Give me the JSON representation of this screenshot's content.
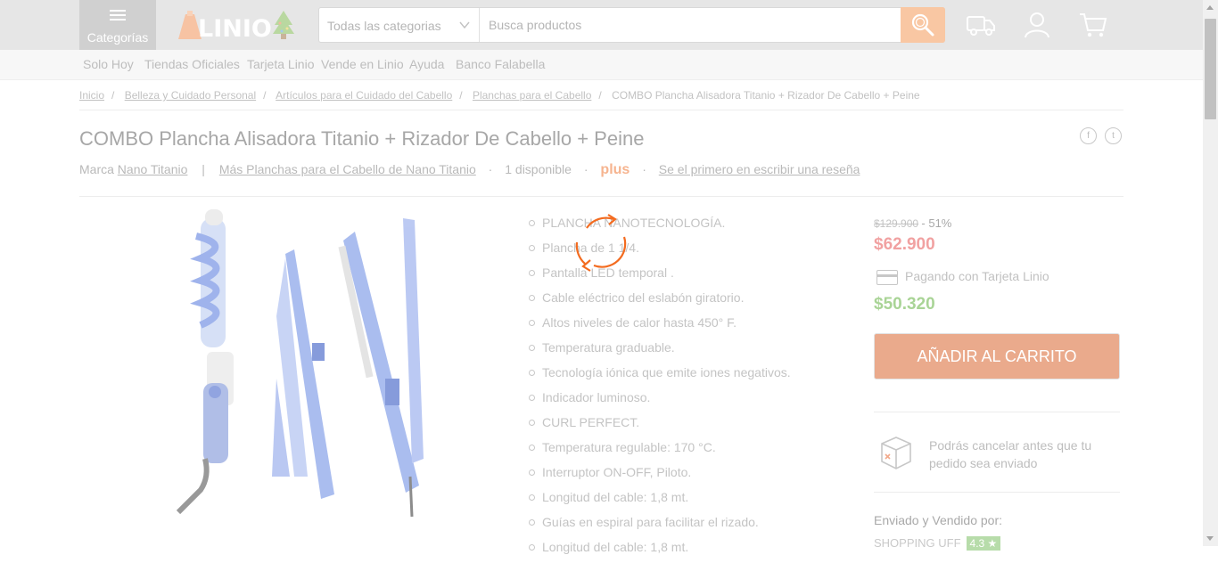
{
  "header": {
    "menu_label": "Categorías",
    "logo_text": "LINIO",
    "search": {
      "category_value": "Todas las categorias",
      "placeholder": "Busca productos"
    },
    "icons": [
      "menu-icon",
      "christmas-tree-icon",
      "search-icon",
      "truck-icon",
      "user-icon",
      "cart-icon"
    ]
  },
  "nav": {
    "links": [
      "Solo Hoy",
      "Tiendas Oficiales",
      "Tarjeta Linio",
      "Vende en Linio",
      "Ayuda",
      "Banco Falabella"
    ]
  },
  "breadcrumbs": [
    "Inicio",
    "Belleza y Cuidado Personal",
    "Artículos para el Cuidado del Cabello",
    "Planchas para el Cabello",
    "COMBO Plancha Alisadora Titanio + Rizador De Cabello + Peine"
  ],
  "product": {
    "title": "COMBO Plancha Alisadora Titanio + Rizador De Cabello + Peine",
    "brand_prefix": "Marca",
    "brand": "Nano Titanio",
    "more_link": "Más Planchas para el Cabello de Nano Titanio",
    "stock": "1 disponible",
    "plus": "plus",
    "review_link": "Se el primero en escribir una reseña",
    "features": [
      "PLANCHA NANOTECNOLOGÍA.",
      "Plancha de 1 1/4.",
      "Pantalla LED temporal .",
      "Cable eléctrico del eslabón giratorio.",
      "Altos niveles de calor hasta 450° F.",
      "Temperatura graduable.",
      "Tecnología iónica que emite iones negativos.",
      "Indicador luminoso.",
      "CURL PERFECT.",
      "Temperatura regulable: 170 °C.",
      "Interruptor ON-OFF, Piloto.",
      "Longitud del cable: 1,8 mt.",
      "Guías en espiral para facilitar el rizado.",
      "Longitud del cable: 1,8 mt."
    ]
  },
  "pricing": {
    "old_price": "$129.900",
    "discount": "- 51%",
    "price": "$62.900",
    "card_label": "Pagando con Tarjeta Linio",
    "card_price": "$50.320",
    "add_to_cart": "AÑADIR AL CARRITO",
    "cancel_note": "Podrás cancelar antes que tu pedido sea enviado",
    "sold_by_label": "Enviado y Vendido por:",
    "seller": "SHOPPING UFF",
    "seller_rating": "4.3 ★"
  },
  "colors": {
    "accent": "#f9c7a3",
    "price": "#f1a1a1",
    "card_price": "#a9d496",
    "spinner": "#f36b1f"
  }
}
